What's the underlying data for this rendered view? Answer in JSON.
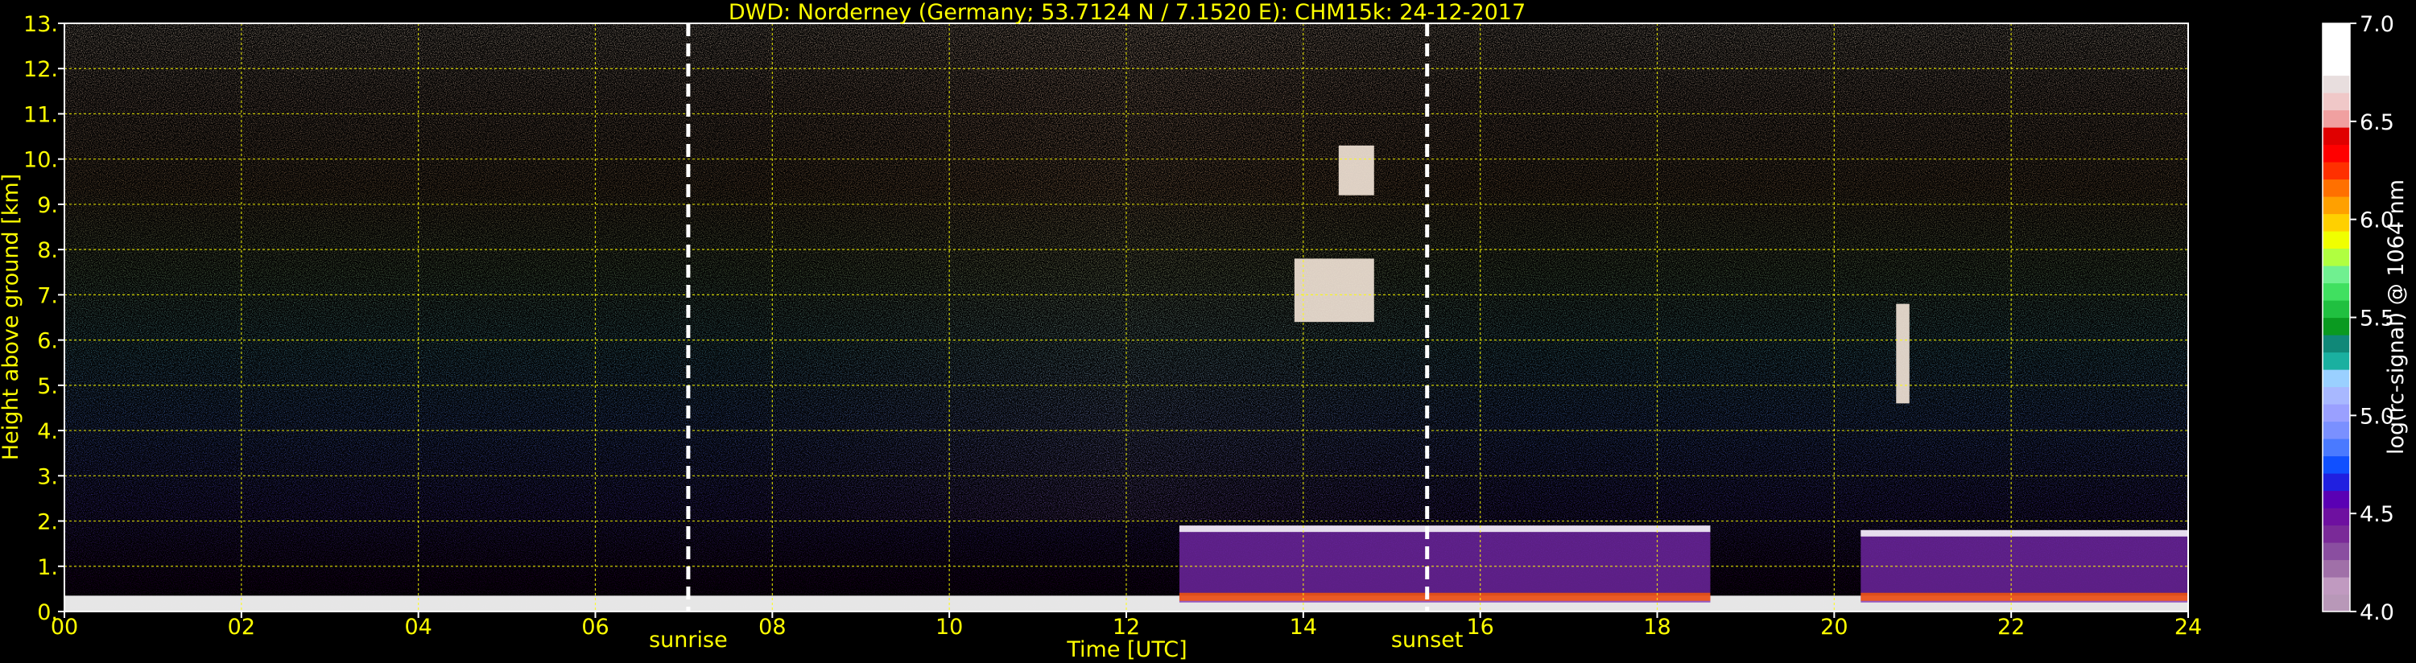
{
  "chart_data": {
    "type": "heatmap",
    "title": "DWD: Norderney (Germany; 53.7124 N / 7.1520 E):    CHM15k: 24-12-2017",
    "xlabel": "Time [UTC]",
    "ylabel": "Height above ground [km]",
    "xlim": [
      0,
      24
    ],
    "ylim": [
      0,
      13
    ],
    "x_ticks": [
      0,
      2,
      4,
      6,
      8,
      10,
      12,
      14,
      16,
      18,
      20,
      22,
      24
    ],
    "x_tick_labels": [
      "00",
      "02",
      "04",
      "06",
      "08",
      "10",
      "12",
      "14",
      "16",
      "18",
      "20",
      "22",
      "24"
    ],
    "y_ticks": [
      0,
      1,
      2,
      3,
      4,
      5,
      6,
      7,
      8,
      9,
      10,
      11,
      12,
      13
    ],
    "y_tick_labels": [
      "0.",
      "1.",
      "2.",
      "3.",
      "4.",
      "5.",
      "6.",
      "7.",
      "8.",
      "9.",
      "10.",
      "11.",
      "12.",
      "13."
    ],
    "grid": true,
    "annotations": [
      {
        "label": "sunrise",
        "x": 7.05
      },
      {
        "label": "sunset",
        "x": 15.4
      }
    ],
    "colorbar": {
      "label": "log(rc-signal) @ 1064 nm",
      "range": [
        4.0,
        7.0
      ],
      "ticks": [
        4.0,
        4.5,
        5.0,
        5.5,
        6.0,
        6.5,
        7.0
      ],
      "tick_labels": [
        "4.0",
        "4.5",
        "5.0",
        "5.5",
        "6.0",
        "6.5",
        "7.0"
      ],
      "colors": [
        "#b898b8",
        "#c09ac0",
        "#a070a8",
        "#8a4ea0",
        "#7a2a98",
        "#6e10a0",
        "#5a00b4",
        "#2020e0",
        "#1050ff",
        "#4a7aff",
        "#7a90ff",
        "#9aa0ff",
        "#a8b8ff",
        "#9ad0ff",
        "#1ab0a0",
        "#108878",
        "#0a9a20",
        "#20c040",
        "#40e060",
        "#70f090",
        "#b0ff40",
        "#f0ff00",
        "#ffd000",
        "#ffa000",
        "#ff7000",
        "#ff3000",
        "#ff0000",
        "#e00000",
        "#f0a0a0",
        "#f0c8c8",
        "#e8dede",
        "#ffffff",
        "#ffffff",
        "#ffffff"
      ]
    },
    "features": [
      {
        "kind": "surface_layer",
        "x_range": [
          0,
          24
        ],
        "height_km": [
          0,
          0.35
        ]
      },
      {
        "kind": "aerosol_layer",
        "x_range": [
          12.6,
          18.6
        ],
        "height_km": [
          0.2,
          1.9
        ]
      },
      {
        "kind": "cloud",
        "x_range": [
          13.9,
          14.8
        ],
        "height_km": [
          6.4,
          7.8
        ]
      },
      {
        "kind": "cloud",
        "x_range": [
          14.4,
          14.8
        ],
        "height_km": [
          9.2,
          10.3
        ]
      },
      {
        "kind": "cloud",
        "x_range": [
          20.7,
          20.85
        ],
        "height_km": [
          4.6,
          6.8
        ]
      },
      {
        "kind": "aerosol_layer",
        "x_range": [
          20.3,
          24
        ],
        "height_km": [
          0.2,
          1.8
        ]
      }
    ]
  }
}
